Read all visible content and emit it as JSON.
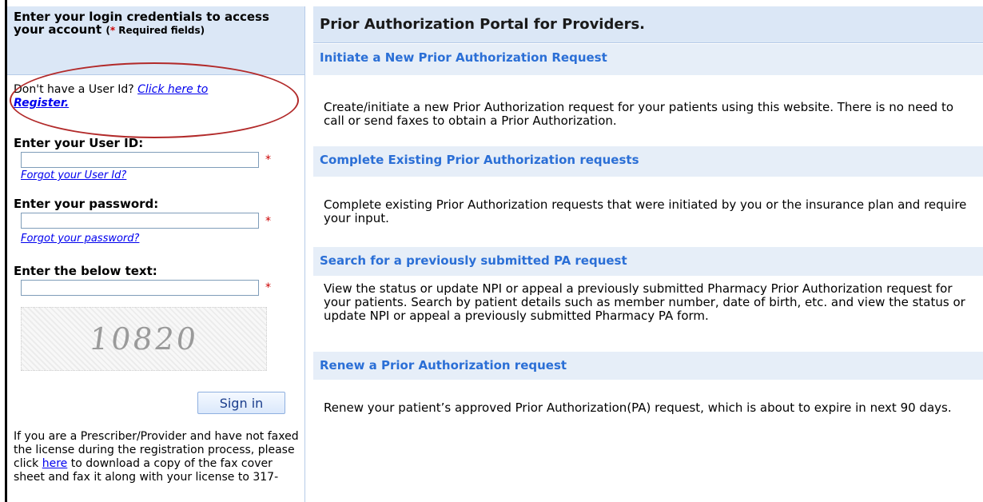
{
  "login": {
    "header_title": "Enter your login credentials to access your account",
    "header_required_paren_open": "(",
    "header_required_star": "*",
    "header_required_text": " Required fields)",
    "register_prompt": "Don't have a User Id?",
    "register_link_part1": "Click here to",
    "register_link_part2": "Register.",
    "user_id_label": "Enter your User ID:",
    "user_id_value": "",
    "forgot_user_id": "Forgot your User Id?",
    "password_label": "Enter your password:",
    "password_value": "",
    "forgot_password": "Forgot your password?",
    "captcha_label": "Enter the below text:",
    "captcha_value": "",
    "captcha_image_text": "10820",
    "required_star": "*",
    "sign_in_label": "Sign in",
    "note_before": "If you are a Prescriber/Provider and have not faxed the license during the registration process, please click",
    "note_link": "here",
    "note_after": "to download a copy of the fax cover sheet and fax it along with your license to 317-"
  },
  "portal": {
    "title": "Prior Authorization Portal for Providers.",
    "sections": [
      {
        "heading": "Initiate a New Prior Authorization Request",
        "text": "Create/initiate a new Prior Authorization request for your patients using this website. There is no need to call or send faxes to obtain a Prior Authorization."
      },
      {
        "heading": "Complete Existing Prior Authorization requests",
        "text": "Complete existing Prior Authorization requests that were initiated by you or the insurance plan and require your input."
      },
      {
        "heading": "Search for a previously submitted PA request",
        "text": "View the status or update NPI or appeal a previously submitted Pharmacy Prior Authorization request for your patients. Search by patient details such as member number, date of birth, etc. and view the status or update NPI or appeal a previously submitted Pharmacy PA form."
      },
      {
        "heading": "Renew a Prior Authorization request",
        "text": "Renew your patient’s approved Prior Authorization(PA) request, which is about to expire in next 90 days."
      }
    ]
  },
  "colors": {
    "header_bg": "#dbe7f6",
    "section_bg": "#e6eef8",
    "section_heading": "#2b6fd6",
    "required": "#cc0000",
    "annotation_oval": "#b22a2a",
    "link": "#0000ee"
  }
}
